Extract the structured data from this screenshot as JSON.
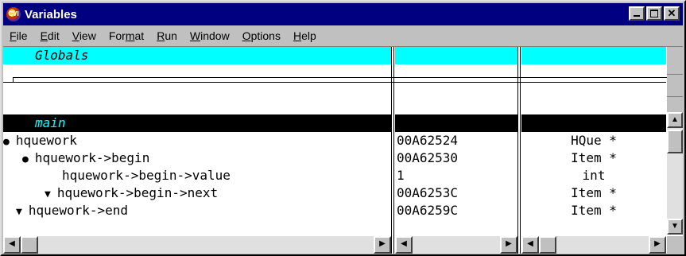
{
  "window": {
    "title": "Variables",
    "icon_text": "CVI",
    "icon": "cvi-app-icon",
    "buttons": [
      "minimize",
      "maximize",
      "close"
    ]
  },
  "menu": [
    "File",
    "Edit",
    "View",
    "Format",
    "Run",
    "Window",
    "Options",
    "Help"
  ],
  "menu_mnemonics": [
    "F",
    "E",
    "V",
    "m",
    "R",
    "W",
    "O",
    "H"
  ],
  "globals": {
    "label": "Globals"
  },
  "main": {
    "label": "main"
  },
  "rows": [
    {
      "bullet": "●",
      "name": "hquework",
      "address": "00A62524",
      "type": "HQue *"
    },
    {
      "bullet": "●",
      "name": "hquework->begin",
      "address": "00A62530",
      "type": "Item *"
    },
    {
      "bullet": "",
      "name": "hquework->begin->value",
      "address": "1",
      "type": "int"
    },
    {
      "bullet": "▼",
      "name": "hquework->begin->next",
      "address": "00A6253C",
      "type": "Item *"
    },
    {
      "bullet": "▼",
      "name": "hquework->end",
      "address": "00A6259C",
      "type": "Item *"
    }
  ],
  "colors": {
    "globals_bg": "#00ffff",
    "main_bg": "#000000",
    "main_text": "#00ffff",
    "title_bg": "#000080"
  }
}
